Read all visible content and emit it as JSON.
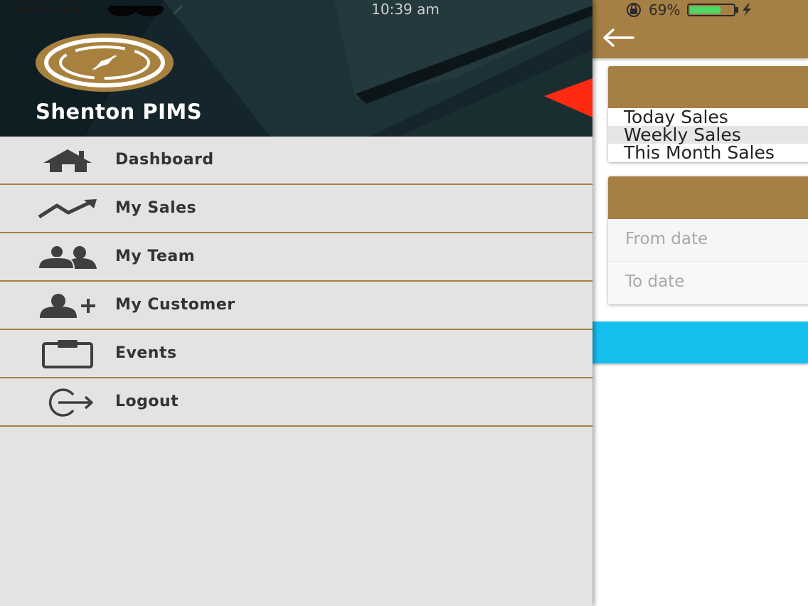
{
  "status_bar": {
    "time": "10:39 am",
    "battery_percent": "69%"
  },
  "drawer": {
    "brand": "Shenton PIMS",
    "menu": [
      {
        "label": "Dashboard",
        "icon": "home-icon"
      },
      {
        "label": "My Sales",
        "icon": "trend-up-icon"
      },
      {
        "label": "My Team",
        "icon": "team-icon"
      },
      {
        "label": "My Customer",
        "icon": "add-user-icon"
      },
      {
        "label": "Events",
        "icon": "clipboard-icon"
      },
      {
        "label": "Logout",
        "icon": "logout-icon"
      }
    ]
  },
  "main": {
    "period_options": [
      "Today Sales",
      "Weekly Sales",
      "This Month Sales"
    ],
    "selected_period": "Weekly Sales",
    "from_date_placeholder": "From date",
    "to_date_placeholder": "To date"
  },
  "colors": {
    "accent_gold": "#a57f44",
    "submit_blue": "#15c0ef",
    "header_dark": "#13232a"
  }
}
